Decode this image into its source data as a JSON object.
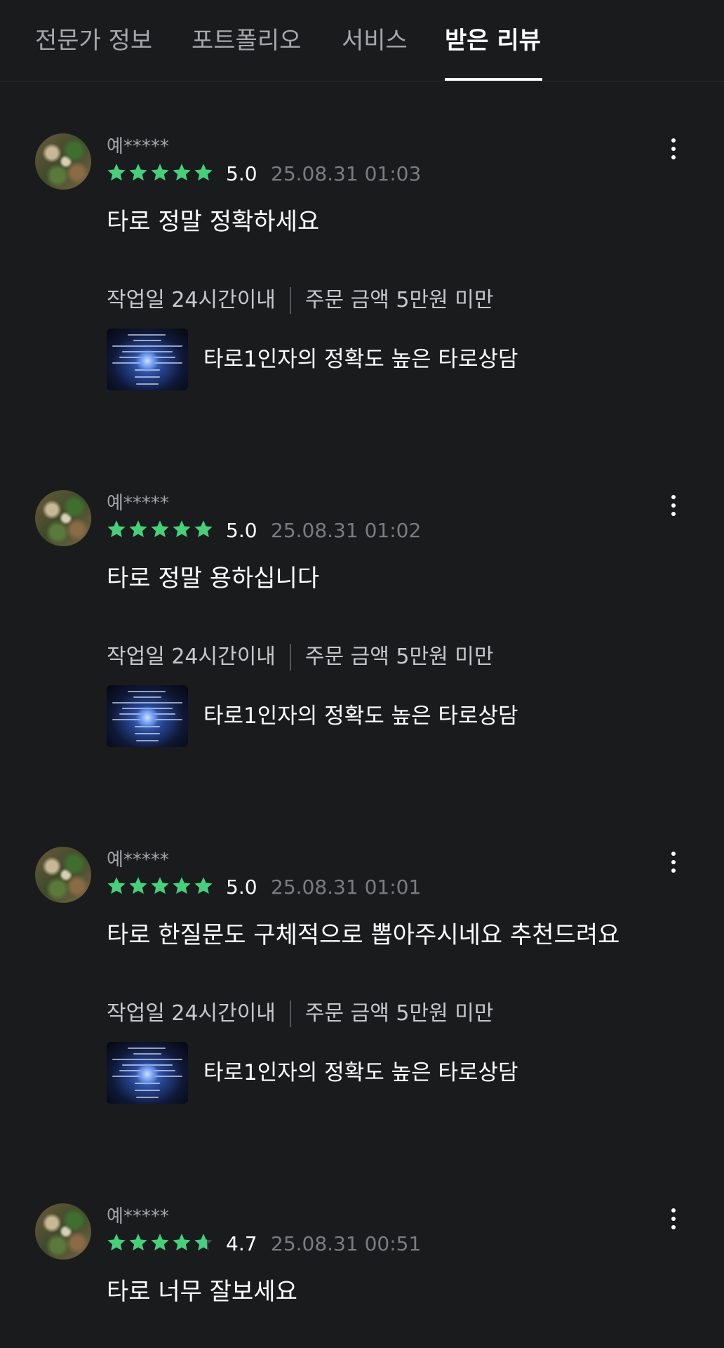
{
  "tabs": [
    {
      "label": "전문가 정보"
    },
    {
      "label": "포트폴리오"
    },
    {
      "label": "서비스"
    },
    {
      "label": "받은 리뷰",
      "active": true
    }
  ],
  "colors": {
    "background": "#1a1b1d",
    "star": "#45d07a",
    "date": "#7b7c80"
  },
  "reviews": [
    {
      "user": "예*****",
      "stars": 5,
      "rating": "5.0",
      "date": "25.08.31 01:03",
      "content": "타로 정말 정확하세요",
      "work_period": "작업일 24시간이내",
      "order_amount": "주문 금액 5만원 미만",
      "service_title": "타로1인자의 정확도 높은 타로상담"
    },
    {
      "user": "예*****",
      "stars": 5,
      "rating": "5.0",
      "date": "25.08.31 01:02",
      "content": "타로 정말 용하십니다",
      "work_period": "작업일 24시간이내",
      "order_amount": "주문 금액 5만원 미만",
      "service_title": "타로1인자의 정확도 높은 타로상담"
    },
    {
      "user": "예*****",
      "stars": 5,
      "rating": "5.0",
      "date": "25.08.31 01:01",
      "content": "타로 한질문도 구체적으로 뽑아주시네요 추천드려요",
      "work_period": "작업일 24시간이내",
      "order_amount": "주문 금액 5만원 미만",
      "service_title": "타로1인자의 정확도 높은 타로상담"
    },
    {
      "user": "예*****",
      "stars": 4.7,
      "rating": "4.7",
      "date": "25.08.31 00:51",
      "content": "타로 너무 잘보세요"
    }
  ]
}
